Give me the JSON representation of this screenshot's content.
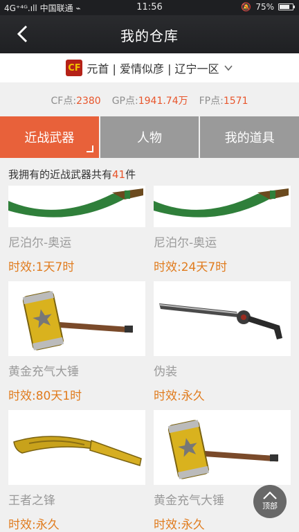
{
  "status_bar": {
    "carrier": "4G⁺⁴ᴳ.ıll 中国联通 ⌁",
    "time": "11:56",
    "battery": "75%",
    "battery_level": 0.75
  },
  "nav": {
    "title": "我的仓库"
  },
  "account": {
    "icon_text": "CF",
    "label": "元首 | 爱情似彦 | 辽宁一区"
  },
  "points": [
    {
      "label": "CF点:",
      "value": "2380"
    },
    {
      "label": "GP点:",
      "value": "1941.74万"
    },
    {
      "label": "FP点:",
      "value": "1571"
    }
  ],
  "tabs": [
    {
      "label": "近战武器",
      "active": true
    },
    {
      "label": "人物",
      "active": false
    },
    {
      "label": "我的道具",
      "active": false
    }
  ],
  "summary": {
    "prefix": "我拥有的近战武器共有",
    "count": "41",
    "suffix": "件"
  },
  "items": [
    {
      "name": "尼泊尔-奥运",
      "expiry": "时效:1天7时",
      "icon": "kukri-green-icon"
    },
    {
      "name": "尼泊尔-奥运",
      "expiry": "时效:24天7时",
      "icon": "kukri-green-icon"
    },
    {
      "name": "黄金充气大锤",
      "expiry": "时效:80天1时",
      "icon": "golden-hammer-icon"
    },
    {
      "name": "伪装",
      "expiry": "时效:永久",
      "icon": "camo-blade-icon"
    },
    {
      "name": "王者之锋",
      "expiry": "时效:永久",
      "icon": "golden-kukri-icon"
    },
    {
      "name": "黄金充气大锤",
      "expiry": "时效:永久",
      "icon": "golden-hammer-icon"
    }
  ],
  "top_button": {
    "label": "顶部"
  }
}
